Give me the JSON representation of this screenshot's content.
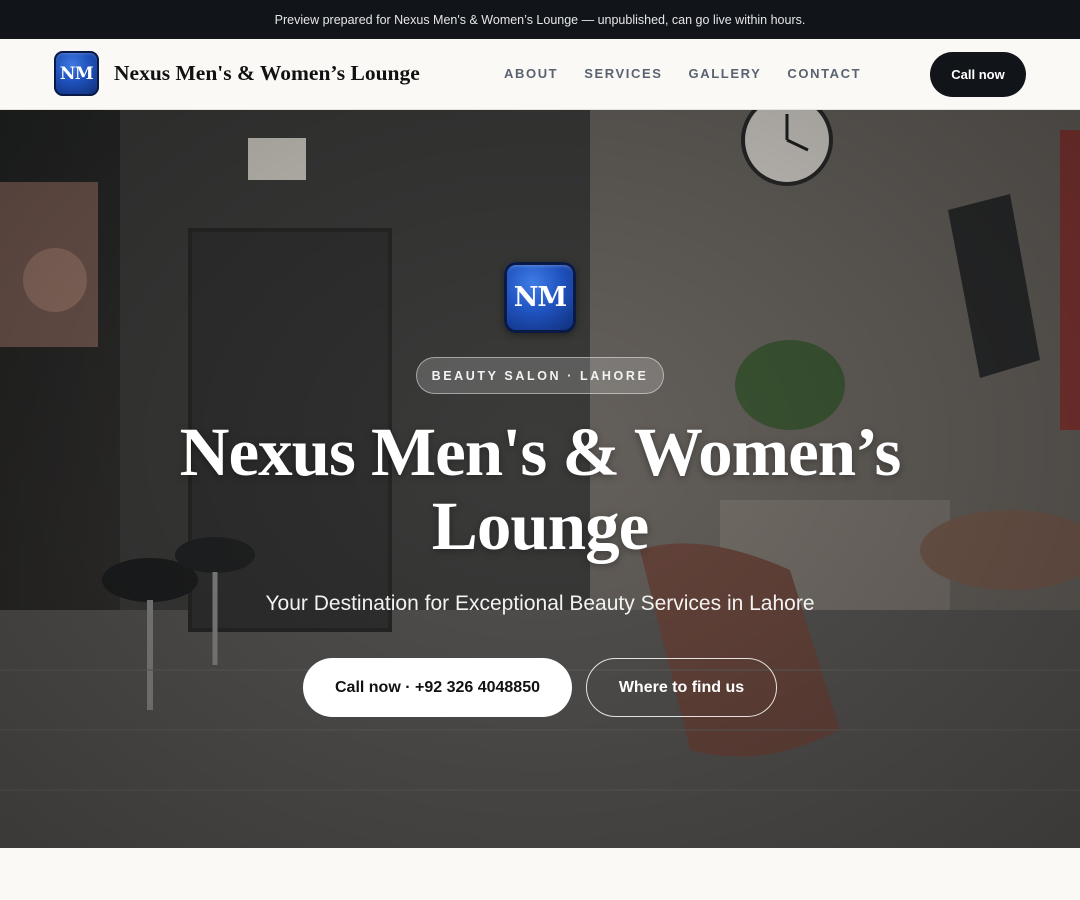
{
  "preview_banner": {
    "text": "Preview prepared for Nexus Men's & Women’s Lounge — unpublished, can go live within hours."
  },
  "header": {
    "logo_text": "NM",
    "brand_name": "Nexus Men's & Women’s Lounge",
    "nav": [
      {
        "label": "ABOUT"
      },
      {
        "label": "SERVICES"
      },
      {
        "label": "GALLERY"
      },
      {
        "label": "CONTACT"
      }
    ],
    "call_label": "Call now"
  },
  "hero": {
    "logo_text": "NM",
    "badge": "BEAUTY SALON · LAHORE",
    "title": "Nexus Men's & Women’s Lounge",
    "subtitle": "Your Destination for Exceptional Beauty Services in Lahore",
    "primary_cta": "Call now · +92 326 4048850",
    "secondary_cta": "Where to find us"
  },
  "colors": {
    "topbar_bg": "#111418",
    "accent_dark": "#111418",
    "logo_blue": "#1f52be",
    "page_bg": "#faf9f6"
  }
}
